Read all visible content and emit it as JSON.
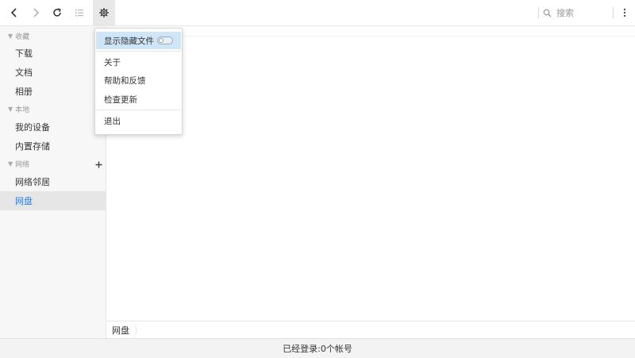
{
  "toolbar": {
    "search_placeholder": "搜索",
    "icons": [
      "back-icon",
      "forward-icon",
      "refresh-icon",
      "list-view-icon",
      "settings-icon",
      "search-icon",
      "more-icon"
    ]
  },
  "sidebar": {
    "sections": [
      {
        "label": "收藏",
        "items": [
          "下载",
          "文档",
          "相册"
        ]
      },
      {
        "label": "本地",
        "items": [
          "我的设备",
          "内置存储"
        ]
      },
      {
        "label": "网络",
        "items": [
          "网络邻居",
          "网盘"
        ]
      }
    ],
    "selected": "网盘"
  },
  "menu": {
    "items": [
      {
        "label": "显示隐藏文件",
        "toggle": false
      },
      {
        "label": "关于"
      },
      {
        "label": "帮助和反馈"
      },
      {
        "label": "检查更新"
      },
      {
        "label": "退出"
      }
    ]
  },
  "breadcrumb": {
    "current": "网盘"
  },
  "status": {
    "text": "已经登录:0个帐号"
  },
  "colors": {
    "accent": "#2f7fd8",
    "menu_highlight": "#cfe6f9"
  }
}
